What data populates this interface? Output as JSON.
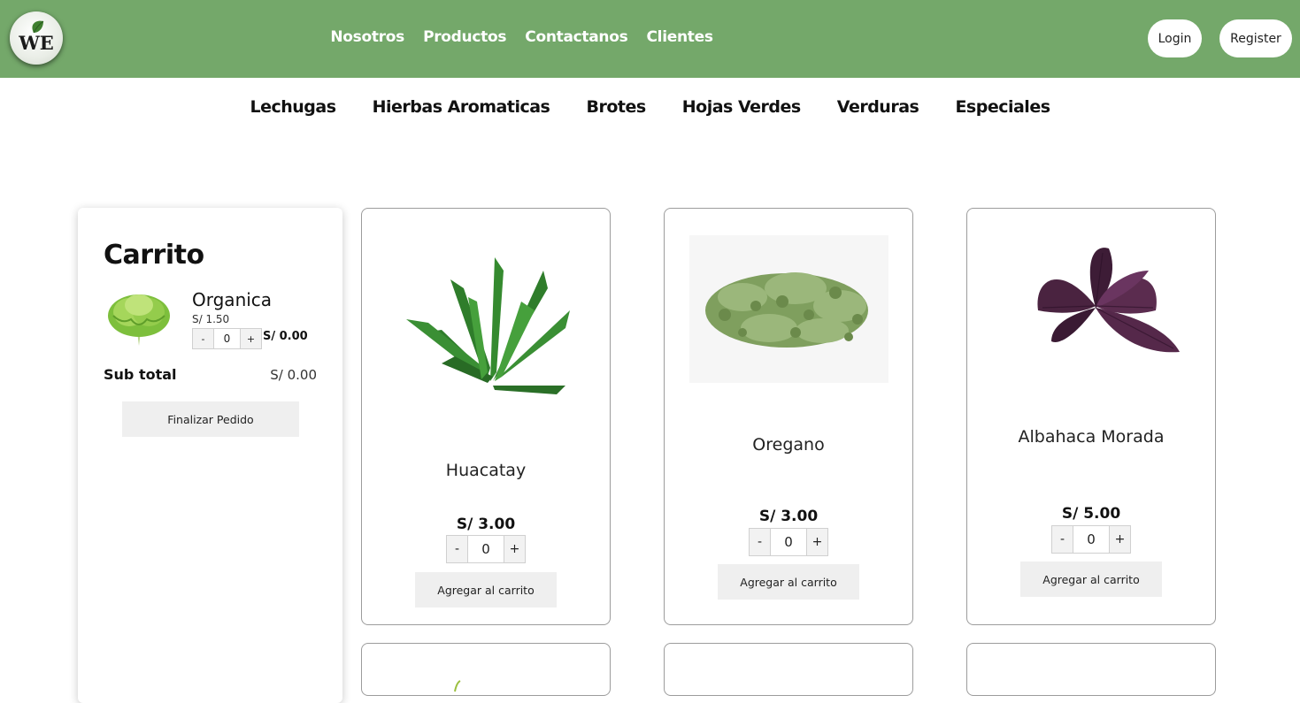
{
  "header": {
    "logo_text": "WE",
    "nav": [
      "Nosotros",
      "Productos",
      "Contactanos",
      "Clientes"
    ],
    "login_label": "Login",
    "register_label": "Register"
  },
  "categories": [
    "Lechugas",
    "Hierbas Aromaticas",
    "Brotes",
    "Hojas Verdes",
    "Verduras",
    "Especiales"
  ],
  "cart": {
    "title": "Carrito",
    "items": [
      {
        "name": "Organica",
        "unit_price": "S/ 1.50",
        "qty": "0",
        "line_total": "S/ 0.00",
        "minus": "-",
        "plus": "+",
        "image": "lettuce-icon"
      }
    ],
    "subtotal_label": "Sub total",
    "subtotal_value": "S/ 0.00",
    "finish_label": "Finalizar Pedido"
  },
  "products": [
    {
      "name": "Huacatay",
      "price": "S/ 3.00",
      "qty": "0",
      "minus": "-",
      "plus": "+",
      "add_label": "Agregar al carrito",
      "image": "huacatay-herb-icon"
    },
    {
      "name": "Oregano",
      "price": "S/ 3.00",
      "qty": "0",
      "minus": "-",
      "plus": "+",
      "add_label": "Agregar al carrito",
      "image": "oregano-herb-icon"
    },
    {
      "name": "Albahaca Morada",
      "price": "S/ 5.00",
      "qty": "0",
      "minus": "-",
      "plus": "+",
      "add_label": "Agregar al carrito",
      "image": "purple-basil-icon"
    }
  ],
  "colors": {
    "header_bg": "#74a86a",
    "button_bg": "#efefef",
    "card_border": "#9c9c9c"
  }
}
